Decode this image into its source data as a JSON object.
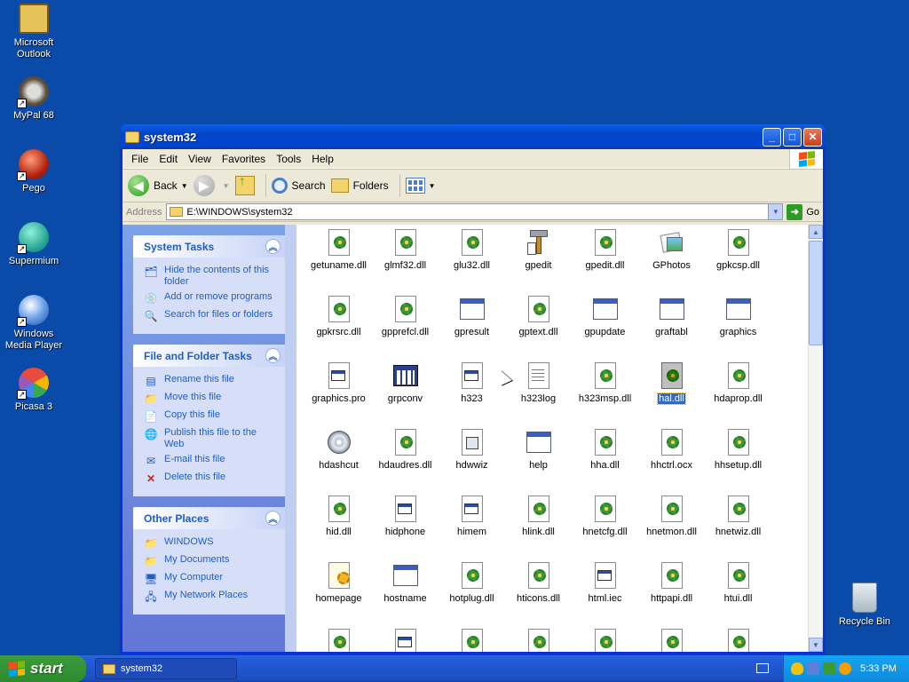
{
  "desktop": {
    "icons": [
      {
        "label": "Microsoft Outlook",
        "icon": "outlook-icon"
      },
      {
        "label": "MyPal 68",
        "icon": "mypal-icon"
      },
      {
        "label": "Pego",
        "icon": "pego-icon"
      },
      {
        "label": "Supermium",
        "icon": "supermium-icon"
      },
      {
        "label": "Windows Media Player",
        "icon": "media-player-icon"
      },
      {
        "label": "Picasa 3",
        "icon": "picasa-icon"
      }
    ],
    "recycle_bin": "Recycle Bin"
  },
  "window": {
    "title": "system32",
    "menu": [
      "File",
      "Edit",
      "View",
      "Favorites",
      "Tools",
      "Help"
    ],
    "toolbar": {
      "back": "Back",
      "search": "Search",
      "folders": "Folders"
    },
    "address": {
      "label": "Address",
      "value": "E:\\WINDOWS\\system32",
      "go": "Go"
    }
  },
  "tasks": {
    "system": {
      "title": "System Tasks",
      "items": [
        "Hide the contents of this folder",
        "Add or remove programs",
        "Search for files or folders"
      ]
    },
    "file": {
      "title": "File and Folder Tasks",
      "items": [
        "Rename this file",
        "Move this file",
        "Copy this file",
        "Publish this file to the Web",
        "E-mail this file",
        "Delete this file"
      ]
    },
    "other": {
      "title": "Other Places",
      "items": [
        "WINDOWS",
        "My Documents",
        "My Computer",
        "My Network Places"
      ]
    }
  },
  "files": [
    {
      "name": "getuname.dll",
      "type": "dll"
    },
    {
      "name": "glmf32.dll",
      "type": "dll"
    },
    {
      "name": "glu32.dll",
      "type": "dll"
    },
    {
      "name": "gpedit",
      "type": "tool"
    },
    {
      "name": "gpedit.dll",
      "type": "dll"
    },
    {
      "name": "GPhotos",
      "type": "photo"
    },
    {
      "name": "gpkcsp.dll",
      "type": "dll"
    },
    {
      "name": "gpkrsrc.dll",
      "type": "dll"
    },
    {
      "name": "gpprefcl.dll",
      "type": "dll"
    },
    {
      "name": "gpresult",
      "type": "exe"
    },
    {
      "name": "gptext.dll",
      "type": "dll"
    },
    {
      "name": "gpupdate",
      "type": "exe"
    },
    {
      "name": "graftabl",
      "type": "exe"
    },
    {
      "name": "graphics",
      "type": "exe"
    },
    {
      "name": "graphics.pro",
      "type": "sys"
    },
    {
      "name": "grpconv",
      "type": "grpconv"
    },
    {
      "name": "h323",
      "type": "sys"
    },
    {
      "name": "h323log",
      "type": "text"
    },
    {
      "name": "h323msp.dll",
      "type": "dll"
    },
    {
      "name": "hal.dll",
      "type": "dll",
      "selected": true
    },
    {
      "name": "hdaprop.dll",
      "type": "dll"
    },
    {
      "name": "hdashcut",
      "type": "disc"
    },
    {
      "name": "hdaudres.dll",
      "type": "dll"
    },
    {
      "name": "hdwwiz",
      "type": "cpl"
    },
    {
      "name": "help",
      "type": "exe"
    },
    {
      "name": "hha.dll",
      "type": "dll"
    },
    {
      "name": "hhctrl.ocx",
      "type": "dll"
    },
    {
      "name": "hhsetup.dll",
      "type": "dll"
    },
    {
      "name": "hid.dll",
      "type": "dll"
    },
    {
      "name": "hidphone",
      "type": "sys"
    },
    {
      "name": "himem",
      "type": "sys"
    },
    {
      "name": "hlink.dll",
      "type": "dll"
    },
    {
      "name": "hnetcfg.dll",
      "type": "dll"
    },
    {
      "name": "hnetmon.dll",
      "type": "dll"
    },
    {
      "name": "hnetwiz.dll",
      "type": "dll"
    },
    {
      "name": "homepage",
      "type": "homepage"
    },
    {
      "name": "hostname",
      "type": "exe"
    },
    {
      "name": "hotplug.dll",
      "type": "dll"
    },
    {
      "name": "hticons.dll",
      "type": "dll"
    },
    {
      "name": "html.iec",
      "type": "sys"
    },
    {
      "name": "httpapi.dll",
      "type": "dll"
    },
    {
      "name": "htui.dll",
      "type": "dll"
    },
    {
      "name": "",
      "type": "dll"
    },
    {
      "name": "",
      "type": "sys"
    },
    {
      "name": "",
      "type": "dll"
    },
    {
      "name": "",
      "type": "dll"
    },
    {
      "name": "",
      "type": "dll"
    },
    {
      "name": "",
      "type": "dll"
    },
    {
      "name": "",
      "type": "dll"
    }
  ],
  "taskbar": {
    "start": "start",
    "task": "system32",
    "clock": "5:33 PM"
  }
}
